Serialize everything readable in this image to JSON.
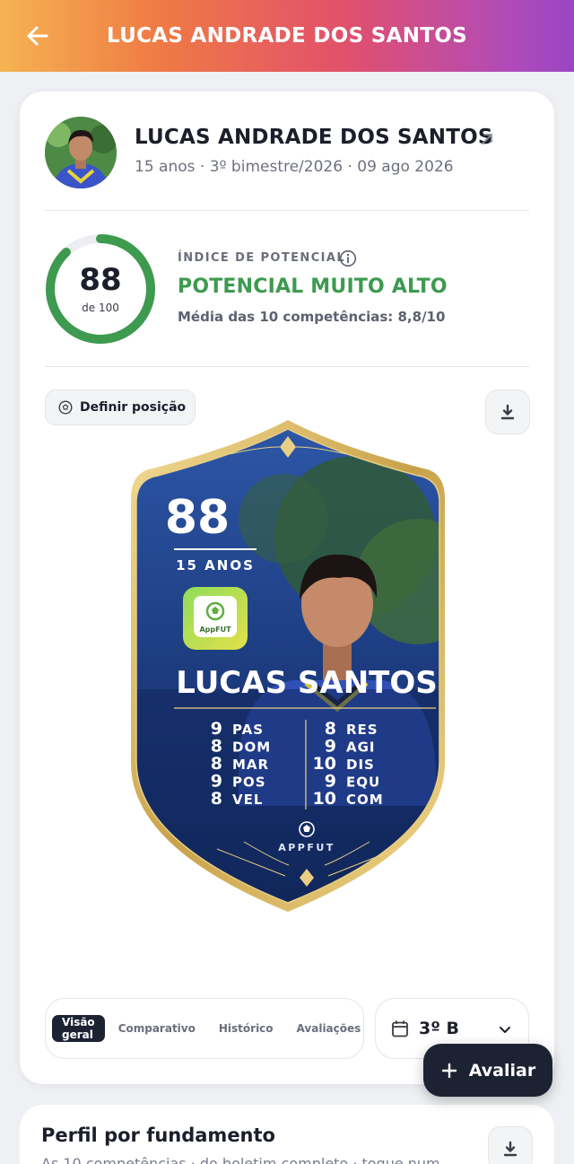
{
  "header": {
    "title": "LUCAS ANDRADE DOS SANTOS"
  },
  "profile": {
    "name": "LUCAS ANDRADE DOS SANTOS",
    "subtitle": "15 anos · 3º bimestre/2026 · 09 ago 2026"
  },
  "potential": {
    "score": "88",
    "score_of": "de 100",
    "score_fraction": 0.88,
    "label": "ÍNDICE DE POTENCIAL",
    "value": "POTENCIAL MUITO ALTO",
    "average": "Média das 10 competências: 8,8/10",
    "accent_color": "#3d9a4f"
  },
  "actions": {
    "set_position": "Definir posição",
    "set_position_icon": "soccer-ball-icon",
    "download_icon": "download-icon"
  },
  "player_card": {
    "rating": "88",
    "age": "15 ANOS",
    "badge": "AppFUT",
    "name": "LUCAS SANTOS",
    "brand": "APPFUT",
    "stats_left": [
      {
        "value": "9",
        "label": "PAS"
      },
      {
        "value": "8",
        "label": "DOM"
      },
      {
        "value": "8",
        "label": "MAR"
      },
      {
        "value": "9",
        "label": "POS"
      },
      {
        "value": "8",
        "label": "VEL"
      }
    ],
    "stats_right": [
      {
        "value": "8",
        "label": "RES"
      },
      {
        "value": "9",
        "label": "AGI"
      },
      {
        "value": "10",
        "label": "DIS"
      },
      {
        "value": "9",
        "label": "EQU"
      },
      {
        "value": "10",
        "label": "COM"
      }
    ]
  },
  "tabs": [
    {
      "label": "Visão geral",
      "active": true
    },
    {
      "label": "Comparativo",
      "active": false
    },
    {
      "label": "Histórico",
      "active": false
    },
    {
      "label": "Avaliações",
      "active": false
    }
  ],
  "term_select": {
    "value": "3º B"
  },
  "fab": {
    "label": "Avaliar"
  },
  "fundamentals": {
    "title": "Perfil por fundamento",
    "subtitle": "As 10 competências · do boletim completo · toque num"
  }
}
